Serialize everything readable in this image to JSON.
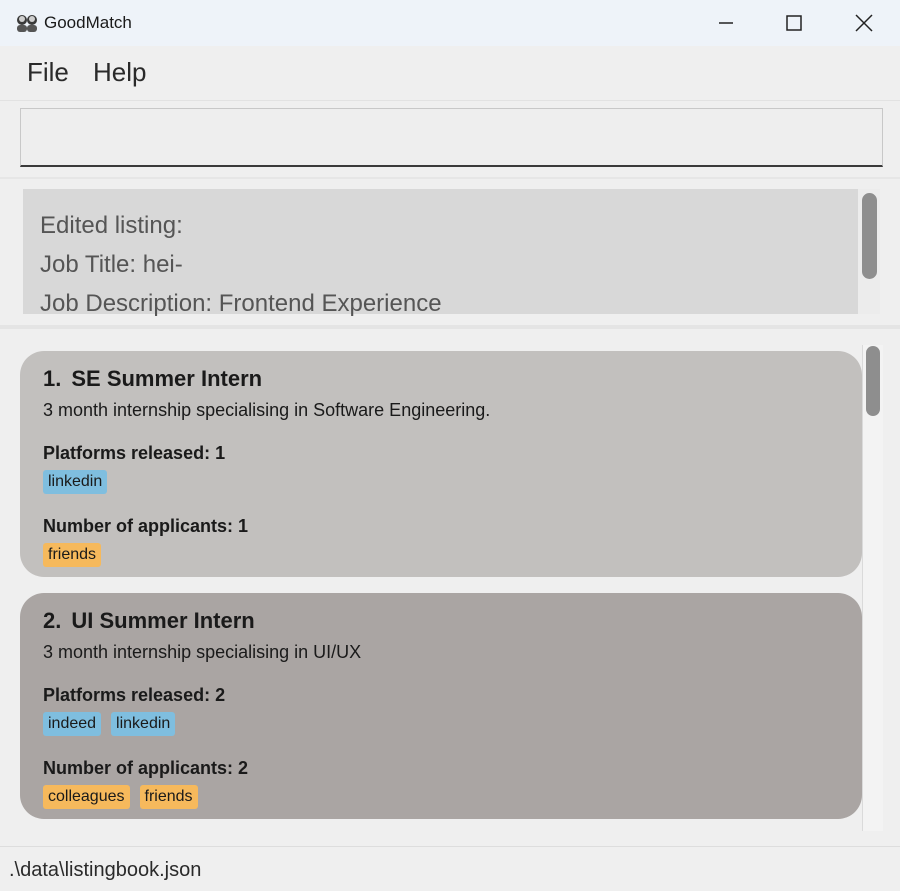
{
  "window": {
    "title": "GoodMatch",
    "icon": "two-people-icon"
  },
  "menu": {
    "items": [
      "File",
      "Help"
    ]
  },
  "command": {
    "value": "",
    "placeholder": ""
  },
  "result": {
    "lines": [
      "Edited listing:",
      "Job Title: hei-",
      "Job Description: Frontend Experience"
    ]
  },
  "listings": [
    {
      "index": "1.",
      "title": "SE Summer Intern",
      "description": "3 month internship specialising in Software Engineering.",
      "platforms_label": "Platforms released: 1",
      "platforms": [
        "linkedin"
      ],
      "applicants_label": "Number of applicants: 1",
      "applicants": [
        "friends"
      ],
      "color": "#c2c0be"
    },
    {
      "index": "2.",
      "title": "UI Summer Intern",
      "description": "3 month internship specialising in UI/UX",
      "platforms_label": "Platforms released: 2",
      "platforms": [
        "indeed",
        "linkedin"
      ],
      "applicants_label": "Number of applicants: 2",
      "applicants": [
        "colleagues",
        "friends"
      ],
      "color": "#aaa5a3"
    }
  ],
  "status": {
    "path": ".\\data\\listingbook.json"
  },
  "colors": {
    "platform_tag": "#7fbedf",
    "applicant_tag": "#f6b95c"
  }
}
